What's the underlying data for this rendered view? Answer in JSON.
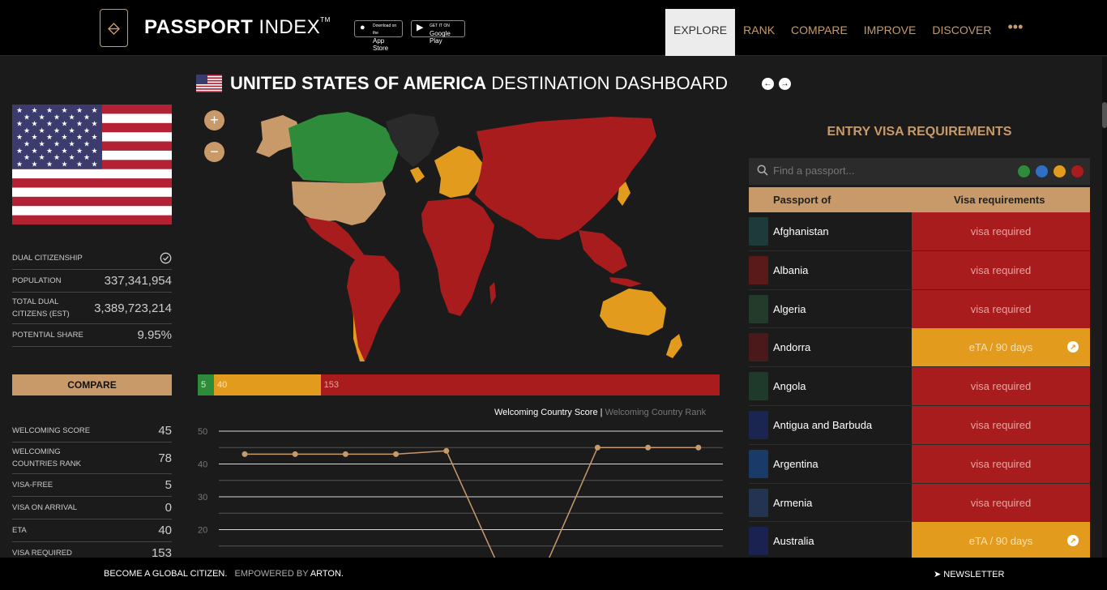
{
  "header": {
    "brand_bold": "PASSPORT",
    "brand_rest": " INDEX",
    "brand_tm": "TM",
    "app_store_small": "Download on the",
    "app_store": "App Store",
    "google_play_small": "GET IT ON",
    "google_play": "Google Play",
    "nav": [
      "EXPLORE",
      "RANK",
      "COMPARE",
      "IMPROVE",
      "DISCOVER"
    ],
    "nav_active": "EXPLORE",
    "more": "•••"
  },
  "title": {
    "country": "UNITED STATES OF AMERICA",
    "suffix": " DESTINATION DASHBOARD",
    "prev": "←",
    "next": "→"
  },
  "stats": {
    "dual_citizenship": "DUAL CITIZENSHIP",
    "population_label": "POPULATION",
    "population": "337,341,954",
    "total_dual_label": "TOTAL DUAL CITIZENS (EST)",
    "total_dual": "3,389,723,214",
    "potential_label": "POTENTIAL SHARE",
    "potential": "9.95%",
    "compare": "COMPARE",
    "welcoming_score_label": "WELCOMING SCORE",
    "welcoming_score": "45",
    "welcoming_rank_label": "WELCOMING COUNTRIES RANK",
    "welcoming_rank": "78",
    "visa_free_label": "VISA-FREE",
    "visa_free": "5",
    "voa_label": "VISA ON ARRIVAL",
    "voa": "0",
    "eta_label": "ETA",
    "eta": "40",
    "visa_required_label": "VISA REQUIRED",
    "visa_required": "153"
  },
  "map": {
    "zoom_in": "+",
    "zoom_out": "−"
  },
  "summary_bar": {
    "green": "5",
    "orange": "40",
    "red": "153",
    "colors": {
      "green": "#2e8b3a",
      "orange": "#e39b1e",
      "red": "#a81c1e"
    }
  },
  "chart_legend": {
    "active": "Welcoming Country Score",
    "sep": " | ",
    "inactive": "Welcoming Country Rank"
  },
  "chart_data": {
    "type": "line",
    "values": [
      43,
      43,
      43,
      43,
      44,
      10,
      10,
      45,
      45,
      45
    ],
    "y_ticks": [
      "50",
      "40",
      "30",
      "20"
    ],
    "ylim": [
      10,
      50
    ],
    "color": "#c89a6a"
  },
  "entry": {
    "title": "ENTRY VISA REQUIREMENTS",
    "search_placeholder": "Find a passport...",
    "filter_colors": [
      "#2e8b3a",
      "#2f6fc4",
      "#e39b1e",
      "#a81c1e"
    ],
    "col_passport": "Passport of",
    "col_visa": "Visa requirements",
    "rows": [
      {
        "country": "Afghanistan",
        "req": "visa required",
        "type": "red",
        "pp": "#1f3a3a"
      },
      {
        "country": "Albania",
        "req": "visa required",
        "type": "red",
        "pp": "#5a1a1a"
      },
      {
        "country": "Algeria",
        "req": "visa required",
        "type": "red",
        "pp": "#243a2a"
      },
      {
        "country": "Andorra",
        "req": "eTA / 90 days",
        "type": "orange",
        "pp": "#4a1a1a"
      },
      {
        "country": "Angola",
        "req": "visa required",
        "type": "red",
        "pp": "#1f3a2a"
      },
      {
        "country": "Antigua and Barbuda",
        "req": "visa required",
        "type": "red",
        "pp": "#1a2550"
      },
      {
        "country": "Argentina",
        "req": "visa required",
        "type": "red",
        "pp": "#1a3a6a"
      },
      {
        "country": "Armenia",
        "req": "visa required",
        "type": "red",
        "pp": "#233350"
      },
      {
        "country": "Australia",
        "req": "eTA / 90 days",
        "type": "orange",
        "pp": "#1a2250"
      }
    ]
  },
  "footer": {
    "left": "BECOME A GLOBAL CITIZEN.",
    "empowered": "EMPOWERED BY",
    "arton": "ARTON.",
    "newsletter": "NEWSLETTER"
  }
}
